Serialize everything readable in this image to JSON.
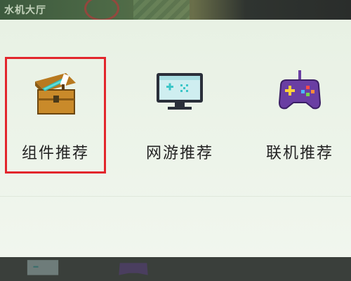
{
  "background": {
    "top_label": "水机大厅"
  },
  "tiles": [
    {
      "label": "组件推荐",
      "icon": "treasure-chest-icon",
      "selected": true
    },
    {
      "label": "网游推荐",
      "icon": "monitor-icon",
      "selected": false
    },
    {
      "label": "联机推荐",
      "icon": "gamepad-icon",
      "selected": false
    }
  ],
  "colors": {
    "selection_border": "#e2262c",
    "sheet_bg": "#e8f1e4",
    "chest_wood": "#c98a2a",
    "monitor_screen": "#cfeef0",
    "gamepad_purple": "#6a3ea3"
  }
}
